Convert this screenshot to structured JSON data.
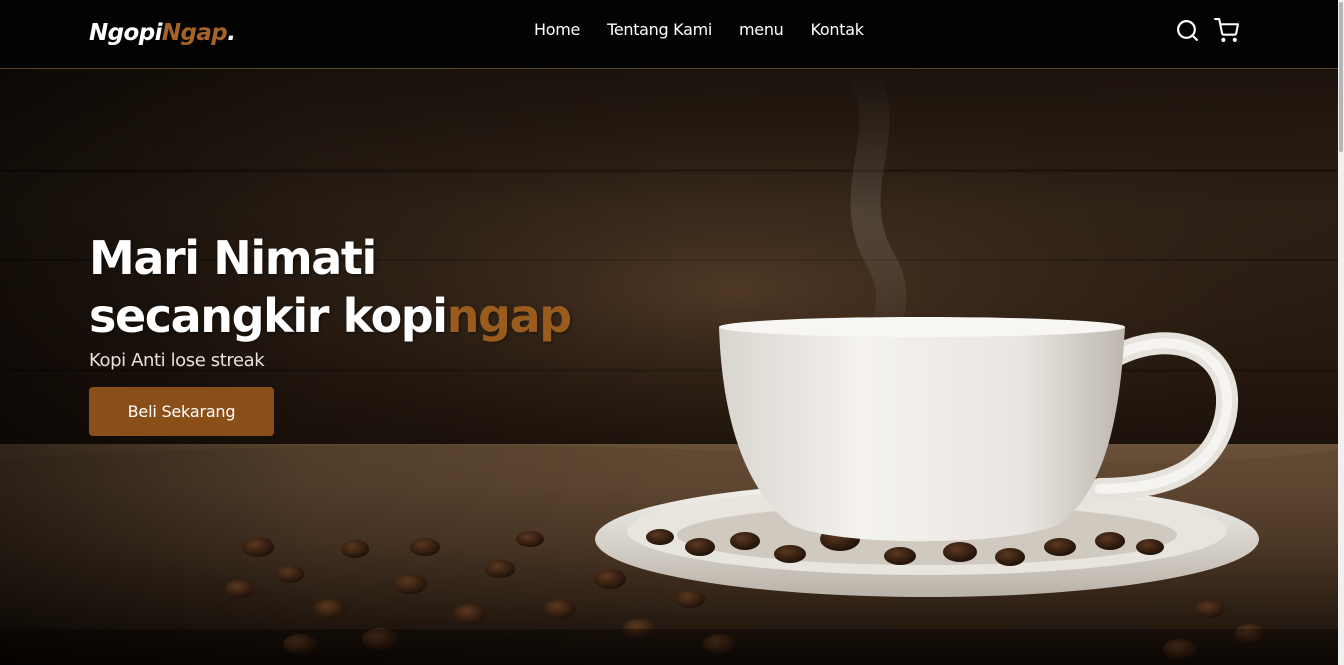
{
  "brand": {
    "part1": "Ngopi",
    "part2": "Ngap",
    "dot": "."
  },
  "nav": {
    "links": [
      "Home",
      "Tentang Kami",
      "menu",
      "Kontak"
    ],
    "icons": [
      "search-icon",
      "cart-icon"
    ]
  },
  "hero": {
    "title_line1": "Mari Nimati",
    "title_line2_prefix": "secangkir kopi",
    "title_line2_accent": "ngap",
    "subtitle": "Kopi Anti lose streak",
    "cta_label": "Beli Sekarang"
  },
  "colors": {
    "accent": "#a56327",
    "button": "#8a4f19",
    "navbar_bg": "#030303"
  }
}
